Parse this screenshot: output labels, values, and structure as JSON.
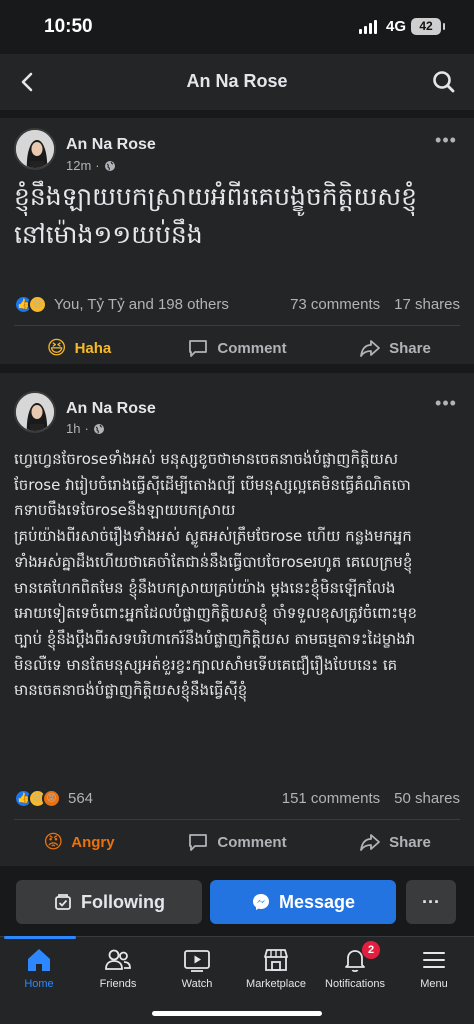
{
  "status_bar": {
    "time": "10:50",
    "network": "4G",
    "battery": "42"
  },
  "nav": {
    "title": "An Na Rose",
    "back_icon": "chevron-left-icon",
    "search_icon": "search-icon"
  },
  "post1": {
    "author": "An Na Rose",
    "time": "12m",
    "privacy_icon": "globe-icon",
    "text_lines": [
      "ខ្ញុំនឹងឡាយបកស្រាយអំពីរគេបង្ខូចកិត្តិយសខ្ញុំ",
      "នៅម៉ោង១១យប់នឹង"
    ],
    "reaction_summary": "You, Tỷ Tỷ and 198 others",
    "comments": "73 comments",
    "shares": "17 shares",
    "actions": {
      "reaction": "Haha",
      "comment": "Comment",
      "share": "Share"
    }
  },
  "post2": {
    "author": "An Na Rose",
    "time": "1h",
    "privacy_icon": "globe-icon",
    "text_lines": [
      "ហ្វេហ្វេនចែroseទាំងអស់ មនុស្សខូចថាមានចេតនាចង់បំផ្លាញកិត្តិយស",
      "ចែrose វារៀបចំរោងធ្វើសុីដើម្បីតោងល្បី បើមនុស្សល្អគេមិនធ្វើគំណិតចោ",
      "កទាបចឹងទេចែroseនឹងឡាយបកស្រាយ",
      "គ្រប់យ៉ាងពីរសាច់រឿងទាំងអស់ ស្លូតអស់ត្រឹមចែrose ហើយ កន្លងមកអ្នក",
      "ទាំងអស់គ្នាដឹងហើយថាគេចាំតែជាន់នឹងធ្វើបាបចែroseរហូត គេលេក្រមខ្ញុំ",
      "មានគេហែកពិតមែន ខ្ញុំនឹងបកស្រាយគ្រប់យ៉ាង ម្ដងនេះខ្ញុំមិនឡើកលែង",
      "អោយទៀតទេចំពោះអ្នកដែលបំផ្លាញកិត្តិយសខ្ញុំ ចាំទទួលខុសត្រូវចំពោះមុខ",
      "ច្បាប់ ខ្ញុំនឹងប្ដឹងពីរសទបរិហាកេរ៍នឹងបំផ្លាញកិត្តិយស តាមធម្មតាទះដៃម្ខាងវា",
      "មិនលឺទេ មានតែមនុស្សអត់ខួរខ្វះក្បាលសាំមទើបគេជឿរឿងបែបនេះ គេ",
      "មានចេតនាចង់បំផ្លាញកិត្តិយសខ្ញុំនឹងធ្វើសុីខ្ញុំ"
    ],
    "reaction_count": "564",
    "comments": "151 comments",
    "shares": "50 shares",
    "actions": {
      "reaction": "Angry",
      "comment": "Comment",
      "share": "Share"
    }
  },
  "profile_buttons": {
    "following": "Following",
    "message": "Message",
    "more": "···"
  },
  "tabs": [
    {
      "label": "Home",
      "icon": "home-icon",
      "active": true
    },
    {
      "label": "Friends",
      "icon": "friends-icon"
    },
    {
      "label": "Watch",
      "icon": "watch-icon"
    },
    {
      "label": "Marketplace",
      "icon": "marketplace-icon"
    },
    {
      "label": "Notifications",
      "icon": "bell-icon",
      "badge": "2"
    },
    {
      "label": "Menu",
      "icon": "menu-icon"
    }
  ],
  "colors": {
    "background": "#18191a",
    "card": "#242526",
    "accent": "#2d88ff",
    "haha": "#f7b928",
    "angry": "#e9710f",
    "badge": "#e41e3f"
  }
}
